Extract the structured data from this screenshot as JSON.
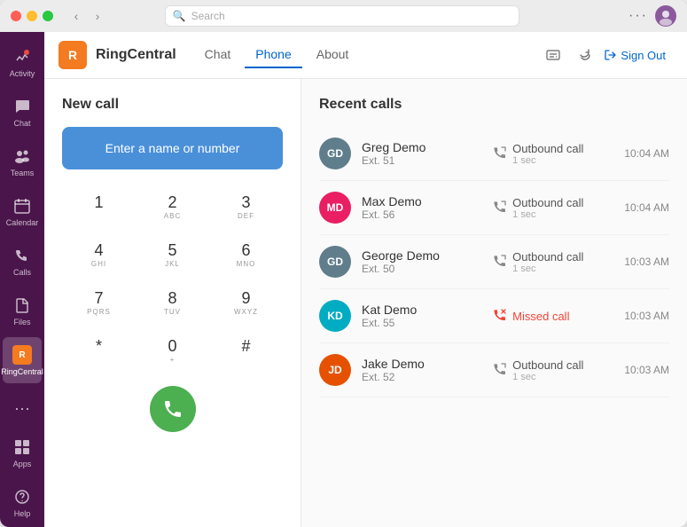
{
  "window": {
    "titlebar": {
      "search_placeholder": "Search",
      "more_label": "···"
    }
  },
  "teams_sidebar": {
    "items": [
      {
        "label": "Activity",
        "icon": "🔔",
        "active": false
      },
      {
        "label": "Chat",
        "icon": "💬",
        "active": false
      },
      {
        "label": "Teams",
        "icon": "👥",
        "active": false
      },
      {
        "label": "Calendar",
        "icon": "📅",
        "active": false
      },
      {
        "label": "Calls",
        "icon": "📞",
        "active": false
      },
      {
        "label": "Files",
        "icon": "📁",
        "active": false
      },
      {
        "label": "RingCentral",
        "icon": "RC",
        "active": true
      }
    ],
    "bottom_items": [
      {
        "label": "Apps",
        "icon": "⊞"
      },
      {
        "label": "Help",
        "icon": "?"
      }
    ]
  },
  "rc_header": {
    "logo_text": "R",
    "brand": "RingCentral",
    "nav": [
      {
        "label": "Chat",
        "active": false
      },
      {
        "label": "Phone",
        "active": true
      },
      {
        "label": "About",
        "active": false
      }
    ],
    "sign_out_label": "Sign Out"
  },
  "new_call": {
    "title": "New call",
    "input_placeholder": "Enter a name or number",
    "keys": [
      {
        "num": "1",
        "sub": ""
      },
      {
        "num": "2",
        "sub": "ABC"
      },
      {
        "num": "3",
        "sub": "DEF"
      },
      {
        "num": "4",
        "sub": "GHI"
      },
      {
        "num": "5",
        "sub": "JKL"
      },
      {
        "num": "6",
        "sub": "MNO"
      },
      {
        "num": "7",
        "sub": "PQRS"
      },
      {
        "num": "8",
        "sub": "TUV"
      },
      {
        "num": "9",
        "sub": "WXYZ"
      },
      {
        "num": "*",
        "sub": ""
      },
      {
        "num": "0",
        "sub": "+"
      },
      {
        "num": "#",
        "sub": ""
      }
    ]
  },
  "recent_calls": {
    "title": "Recent calls",
    "items": [
      {
        "initials": "GD",
        "avatar_color": "#607d8b",
        "name": "Greg Demo",
        "ext": "Ext. 51",
        "type": "Outbound call",
        "missed": false,
        "duration": "1 sec",
        "time": "10:04 AM"
      },
      {
        "initials": "MD",
        "avatar_color": "#e91e63",
        "name": "Max Demo",
        "ext": "Ext. 56",
        "type": "Outbound call",
        "missed": false,
        "duration": "1 sec",
        "time": "10:04 AM"
      },
      {
        "initials": "GD",
        "avatar_color": "#607d8b",
        "name": "George Demo",
        "ext": "Ext. 50",
        "type": "Outbound call",
        "missed": false,
        "duration": "1 sec",
        "time": "10:03 AM"
      },
      {
        "initials": "KD",
        "avatar_color": "#00acc1",
        "name": "Kat Demo",
        "ext": "Ext. 55",
        "type": "Missed call",
        "missed": true,
        "duration": "",
        "time": "10:03 AM"
      },
      {
        "initials": "JD",
        "avatar_color": "#e65100",
        "name": "Jake Demo",
        "ext": "Ext. 52",
        "type": "Outbound call",
        "missed": false,
        "duration": "1 sec",
        "time": "10:03 AM"
      }
    ]
  }
}
